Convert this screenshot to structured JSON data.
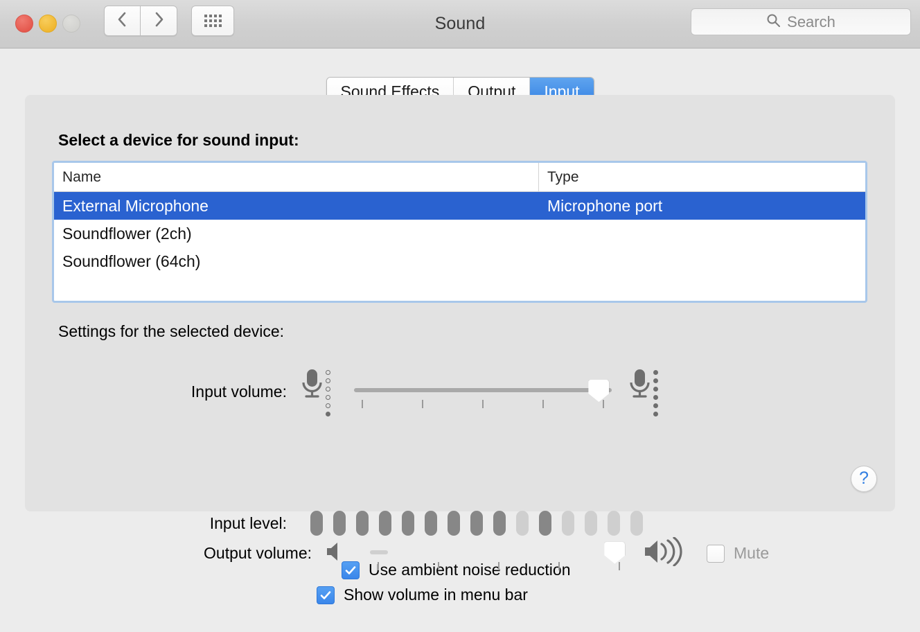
{
  "window": {
    "title": "Sound",
    "traffic_lights": [
      "close",
      "minimize",
      "zoom"
    ]
  },
  "toolbar": {
    "back_icon": "chevron-left-icon",
    "forward_icon": "chevron-right-icon",
    "show_all_icon": "grid-icon",
    "search": {
      "placeholder": "Search",
      "value": "",
      "icon": "search-icon"
    }
  },
  "tabs": [
    {
      "label": "Sound Effects",
      "selected": false
    },
    {
      "label": "Output",
      "selected": false
    },
    {
      "label": "Input",
      "selected": true
    }
  ],
  "input_pane": {
    "device_list_label": "Select a device for sound input:",
    "columns": [
      "Name",
      "Type"
    ],
    "devices": [
      {
        "name": "External Microphone",
        "type": "Microphone port",
        "selected": true
      },
      {
        "name": "Soundflower (2ch)",
        "type": "",
        "selected": false
      },
      {
        "name": "Soundflower (64ch)",
        "type": "",
        "selected": false
      }
    ],
    "settings_label": "Settings for the selected device:",
    "input_volume": {
      "label": "Input volume:",
      "value_percent": 95,
      "tick_count": 5,
      "low_icon": "microphone-low-icon",
      "high_icon": "microphone-high-icon",
      "low_icon_dots_lit": 1,
      "high_icon_dots_lit": 6,
      "icon_dots_total": 6
    },
    "input_level": {
      "label": "Input level:",
      "segments_total": 15,
      "segments_lit": [
        true,
        true,
        true,
        true,
        true,
        true,
        true,
        true,
        true,
        false,
        true,
        false,
        false,
        false,
        false
      ]
    },
    "ambient_noise": {
      "label": "Use ambient noise reduction",
      "checked": true
    },
    "help_button": {
      "glyph": "?",
      "icon": "help-icon"
    }
  },
  "footer": {
    "output_volume": {
      "label": "Output volume:",
      "value_percent": 95,
      "tick_count": 5,
      "low_icon": "speaker-mute-icon",
      "high_icon": "speaker-loud-icon"
    },
    "mute": {
      "label": "Mute",
      "checked": false
    },
    "show_volume_menu_bar": {
      "label": "Show volume in menu bar",
      "checked": true
    }
  },
  "colors": {
    "accent_blue": "#2f7de1",
    "selection_blue": "#2a62d0",
    "checkbox_blue": "#3a86ea",
    "panel_bg": "#e2e2e2",
    "window_bg": "#ececec",
    "meter_lit": "#878787",
    "meter_unlit": "#cfcfcf"
  }
}
